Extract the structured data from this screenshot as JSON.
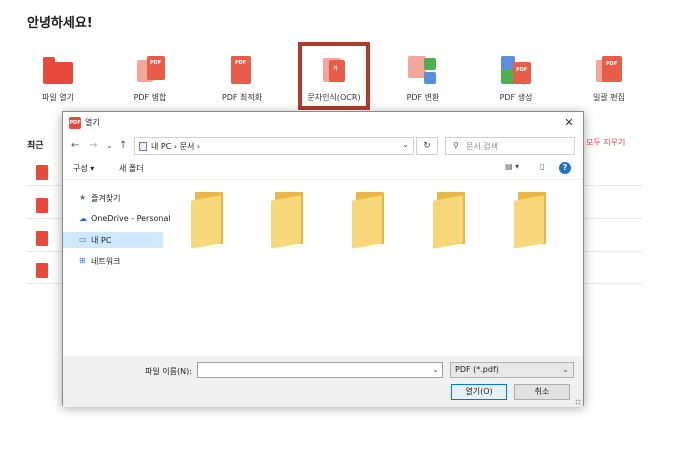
{
  "greeting": "안녕하세요!",
  "tools": [
    {
      "label": "파일 열기",
      "icon": "folder-open-icon"
    },
    {
      "label": "PDF 병합",
      "icon": "pdf-merge-icon"
    },
    {
      "label": "PDF 최적화",
      "icon": "pdf-optimize-icon"
    },
    {
      "label": "문자인식(OCR)",
      "icon": "ocr-icon"
    },
    {
      "label": "PDF 변환",
      "icon": "pdf-convert-icon"
    },
    {
      "label": "PDF 생성",
      "icon": "pdf-create-icon"
    },
    {
      "label": "일괄 편집",
      "icon": "batch-edit-icon"
    }
  ],
  "recent": {
    "title": "최근",
    "clear_all": "모두 지우기",
    "rows": [
      "",
      "",
      "",
      ""
    ]
  },
  "dialog": {
    "title": "열기",
    "close": "✕",
    "app_badge": "PDF",
    "nav": {
      "back": "←",
      "forward": "→",
      "dropdown": "⌄",
      "up": "↑"
    },
    "address": "내 PC › 문서 ›",
    "refresh": "↻",
    "search_placeholder": "문서 검색",
    "toolbar": {
      "organize": "구성 ▾",
      "new_folder": "새 폴더",
      "view": "▤ ▾",
      "pane": "▯",
      "help": "?"
    },
    "sidebar": [
      {
        "label": "즐겨찾기",
        "icon": "star-icon"
      },
      {
        "label": "OneDrive - Personal",
        "icon": "cloud-icon"
      },
      {
        "label": "내 PC",
        "icon": "computer-icon"
      },
      {
        "label": "네트워크",
        "icon": "network-icon"
      }
    ],
    "filename_label": "파일 이름(N):",
    "filename_value": "",
    "filter_value": "PDF (*.pdf)",
    "open_button": "열기(O)",
    "cancel_button": "취소"
  },
  "colors": {
    "accent": "#e8493a",
    "selection": "#cde8ff",
    "highlight_border": "#b23a2a"
  }
}
